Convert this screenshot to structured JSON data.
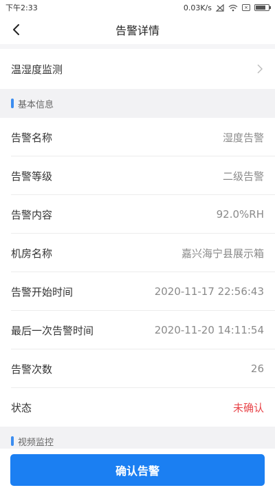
{
  "status_bar": {
    "time": "下午2:33",
    "speed": "0.03K/s"
  },
  "header": {
    "title": "告警详情"
  },
  "monitor": {
    "label": "温湿度监测"
  },
  "basic_section": {
    "title": "基本信息",
    "rows": [
      {
        "label": "告警名称",
        "value": "湿度告警"
      },
      {
        "label": "告警等级",
        "value": "二级告警"
      },
      {
        "label": "告警内容",
        "value": "92.0%RH"
      },
      {
        "label": "机房名称",
        "value": "嘉兴海宁县展示箱"
      },
      {
        "label": "告警开始时间",
        "value": "2020-11-17 22:56:43"
      },
      {
        "label": "最后一次告警时间",
        "value": "2020-11-20 14:11:54"
      },
      {
        "label": "告警次数",
        "value": "26"
      },
      {
        "label": "状态",
        "value": "未确认"
      }
    ]
  },
  "video_section": {
    "title": "视频监控"
  },
  "actions": {
    "confirm_label": "确认告警"
  },
  "colors": {
    "accent": "#1b7ff2",
    "status_unconfirmed": "#e8454a",
    "section_marker": "#3c8df0"
  }
}
